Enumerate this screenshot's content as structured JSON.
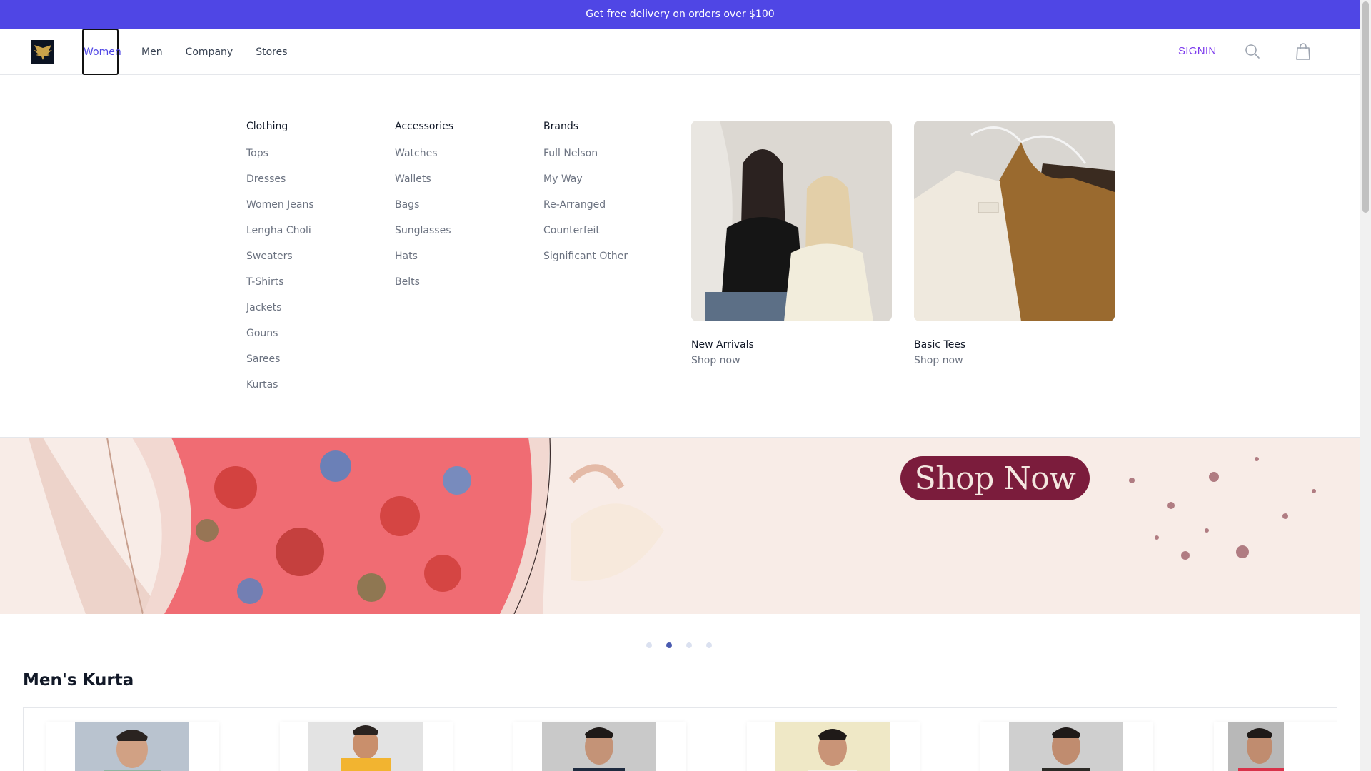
{
  "promo": {
    "text": "Get free delivery on orders over $100"
  },
  "header": {
    "nav": [
      "Women",
      "Men",
      "Company",
      "Stores"
    ],
    "signin": "SIGNIN"
  },
  "mega_menu": {
    "columns": [
      {
        "title": "Clothing",
        "links": [
          "Tops",
          "Dresses",
          "Women Jeans",
          "Lengha Choli",
          "Sweaters",
          "T-Shirts",
          "Jackets",
          "Gouns",
          "Sarees",
          "Kurtas"
        ]
      },
      {
        "title": "Accessories",
        "links": [
          "Watches",
          "Wallets",
          "Bags",
          "Sunglasses",
          "Hats",
          "Belts"
        ]
      },
      {
        "title": "Brands",
        "links": [
          "Full Nelson",
          "My Way",
          "Re-Arranged",
          "Counterfeit",
          "Significant Other"
        ]
      }
    ],
    "features": [
      {
        "name": "New Arrivals",
        "cta": "Shop now"
      },
      {
        "name": "Basic Tees",
        "cta": "Shop now"
      }
    ]
  },
  "banner": {
    "button": "Shop Now"
  },
  "carousel": {
    "count": 4,
    "active_index": 1
  },
  "section": {
    "title": "Men's Kurta"
  },
  "colors": {
    "accent": "#4f46e5",
    "signin": "#7c3aed",
    "banner_button": "#7b1c3c"
  }
}
